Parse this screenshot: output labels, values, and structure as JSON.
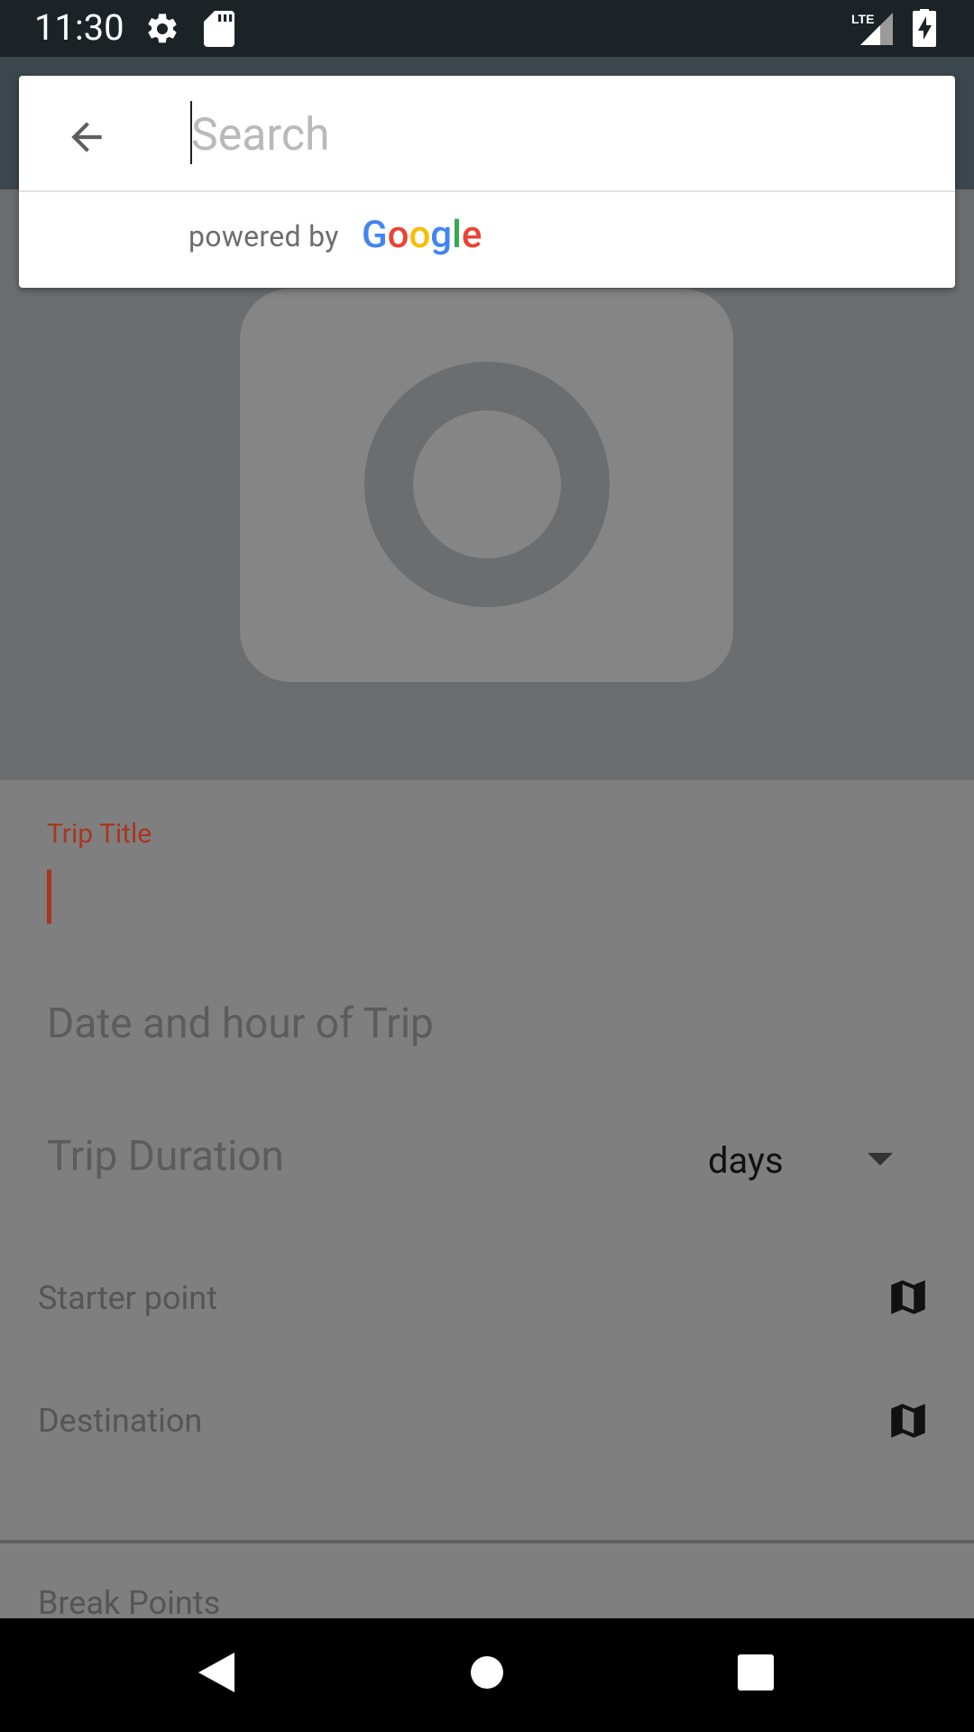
{
  "status_bar": {
    "time": "11:30",
    "network": "LTE",
    "icons": [
      "settings-icon",
      "sd-card-icon",
      "lte-signal-icon",
      "battery-charging-icon"
    ]
  },
  "search": {
    "placeholder": "Search",
    "value": "",
    "attribution_prefix": "powered by",
    "attribution_brand": "Google",
    "brand_letters": [
      "G",
      "o",
      "o",
      "g",
      "l",
      "e"
    ],
    "brand_colors": [
      "#4285F4",
      "#EA4335",
      "#FBBC05",
      "#4285F4",
      "#34A853",
      "#EA4335"
    ]
  },
  "hero": {
    "placeholder_icon": "camera-icon"
  },
  "form": {
    "trip_title_label": "Trip Title",
    "trip_title_value": "",
    "date_placeholder": "Date and hour of Trip",
    "duration_placeholder": "Trip Duration",
    "duration_unit": "days",
    "starter_point_label": "Starter point",
    "destination_label": "Destination",
    "break_points_label": "Break Points"
  },
  "colors": {
    "accent": "#a8371f",
    "status_bar": "#1b2327",
    "toolbar": "#3b474c",
    "scrim": "#7f7f7f"
  },
  "nav_bar": {
    "icons": [
      "back-triangle-icon",
      "home-circle-icon",
      "recents-square-icon"
    ]
  }
}
